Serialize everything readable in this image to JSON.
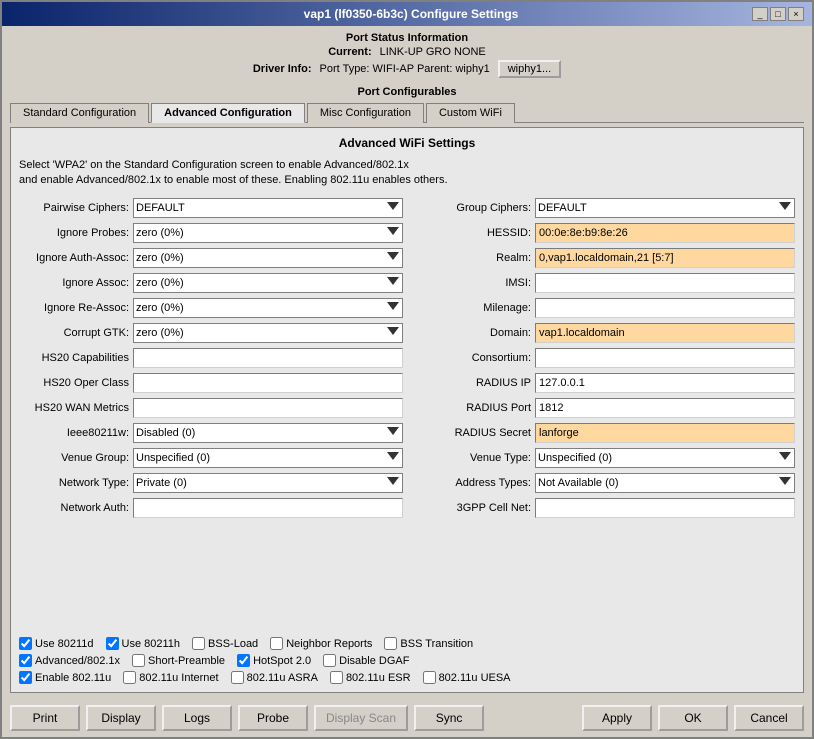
{
  "window": {
    "title": "vap1 (lf0350-6b3c) Configure Settings",
    "minimize_label": "_",
    "maximize_label": "□",
    "close_label": "×"
  },
  "port_status": {
    "section_title": "Port Status Information",
    "current_label": "Current:",
    "current_value": "LINK-UP GRO  NONE",
    "driver_label": "Driver Info:",
    "driver_value": "Port Type: WIFI-AP  Parent: wiphy1",
    "wiphy_btn": "wiphy1..."
  },
  "port_configurables_label": "Port Configurables",
  "tabs": [
    {
      "id": "standard",
      "label": "Standard Configuration"
    },
    {
      "id": "advanced",
      "label": "Advanced Configuration"
    },
    {
      "id": "misc",
      "label": "Misc Configuration"
    },
    {
      "id": "custom-wifi",
      "label": "Custom WiFi"
    }
  ],
  "active_tab": "advanced",
  "advanced": {
    "panel_title": "Advanced WiFi Settings",
    "description_line1": "Select 'WPA2' on the Standard Configuration screen to enable Advanced/802.1x",
    "description_line2": "and enable Advanced/802.1x to enable most of these. Enabling 802.11u enables others.",
    "fields_left": [
      {
        "label": "Pairwise Ciphers:",
        "type": "select",
        "value": "DEFAULT",
        "options": [
          "DEFAULT"
        ]
      },
      {
        "label": "Ignore Probes:",
        "type": "select",
        "value": "zero (0%)",
        "options": [
          "zero (0%)"
        ]
      },
      {
        "label": "Ignore Auth-Assoc:",
        "type": "select",
        "value": "zero (0%)",
        "options": [
          "zero (0%)"
        ]
      },
      {
        "label": "Ignore Assoc:",
        "type": "select",
        "value": "zero (0%)",
        "options": [
          "zero (0%)"
        ]
      },
      {
        "label": "Ignore Re-Assoc:",
        "type": "select",
        "value": "zero (0%)",
        "options": [
          "zero (0%)"
        ]
      },
      {
        "label": "Corrupt GTK:",
        "type": "select",
        "value": "zero (0%)",
        "options": [
          "zero (0%)"
        ]
      },
      {
        "label": "HS20 Capabilities",
        "type": "input",
        "value": ""
      },
      {
        "label": "HS20 Oper Class",
        "type": "input",
        "value": ""
      },
      {
        "label": "HS20 WAN Metrics",
        "type": "input",
        "value": ""
      },
      {
        "label": "Ieee80211w:",
        "type": "select",
        "value": "Disabled (0)",
        "options": [
          "Disabled (0)"
        ]
      },
      {
        "label": "Venue Group:",
        "type": "select",
        "value": "Unspecified (0)",
        "options": [
          "Unspecified (0)"
        ]
      },
      {
        "label": "Network Type:",
        "type": "select",
        "value": "Private (0)",
        "options": [
          "Private (0)"
        ]
      },
      {
        "label": "Network Auth:",
        "type": "input",
        "value": ""
      }
    ],
    "fields_right": [
      {
        "label": "Group Ciphers:",
        "type": "select",
        "value": "DEFAULT",
        "options": [
          "DEFAULT"
        ]
      },
      {
        "label": "HESSID:",
        "type": "input",
        "value": "00:0e:8e:b9:8e:26",
        "highlight": true
      },
      {
        "label": "Realm:",
        "type": "input",
        "value": "0,vap1.localdomain,21 [5:7]",
        "highlight": true
      },
      {
        "label": "IMSI:",
        "type": "input",
        "value": ""
      },
      {
        "label": "Milenage:",
        "type": "input",
        "value": ""
      },
      {
        "label": "Domain:",
        "type": "input",
        "value": "vap1.localdomain",
        "highlight": true
      },
      {
        "label": "Consortium:",
        "type": "input",
        "value": ""
      },
      {
        "label": "RADIUS IP",
        "type": "input",
        "value": "127.0.0.1"
      },
      {
        "label": "RADIUS Port",
        "type": "input",
        "value": "1812"
      },
      {
        "label": "RADIUS Secret",
        "type": "input",
        "value": "lanforge",
        "highlight": true
      },
      {
        "label": "Venue Type:",
        "type": "select",
        "value": "Unspecified (0)",
        "options": [
          "Unspecified (0)"
        ]
      },
      {
        "label": "Address Types:",
        "type": "select",
        "value": "Not Available (0)",
        "options": [
          "Not Available (0)"
        ]
      },
      {
        "label": "3GPP Cell Net:",
        "type": "input",
        "value": ""
      }
    ],
    "checkboxes_row1": [
      {
        "id": "use80211d",
        "label": "Use 80211d",
        "checked": true
      },
      {
        "id": "use80211h",
        "label": "Use 80211h",
        "checked": true
      },
      {
        "id": "bssload",
        "label": "BSS-Load",
        "checked": false
      },
      {
        "id": "neighborreports",
        "label": "Neighbor Reports",
        "checked": false
      },
      {
        "id": "bsstransition",
        "label": "BSS Transition",
        "checked": false
      }
    ],
    "checkboxes_row2": [
      {
        "id": "advanced8021x",
        "label": "Advanced/802.1x",
        "checked": true
      },
      {
        "id": "shortpreamble",
        "label": "Short-Preamble",
        "checked": false
      },
      {
        "id": "hotspot20",
        "label": "HotSpot 2.0",
        "checked": true
      },
      {
        "id": "disabledgaf",
        "label": "Disable DGAF",
        "checked": false
      }
    ],
    "checkboxes_row3": [
      {
        "id": "enable80211u",
        "label": "Enable 802.11u",
        "checked": true
      },
      {
        "id": "80211uinternet",
        "label": "802.11u Internet",
        "checked": false
      },
      {
        "id": "80211uasra",
        "label": "802.11u ASRA",
        "checked": false
      },
      {
        "id": "80211uesr",
        "label": "802.11u ESR",
        "checked": false
      },
      {
        "id": "80211uuesa",
        "label": "802.11u UESA",
        "checked": false
      }
    ]
  },
  "footer": {
    "print": "Print",
    "display": "Display",
    "logs": "Logs",
    "probe": "Probe",
    "display_scan": "Display Scan",
    "sync": "Sync",
    "apply": "Apply",
    "ok": "OK",
    "cancel": "Cancel"
  }
}
